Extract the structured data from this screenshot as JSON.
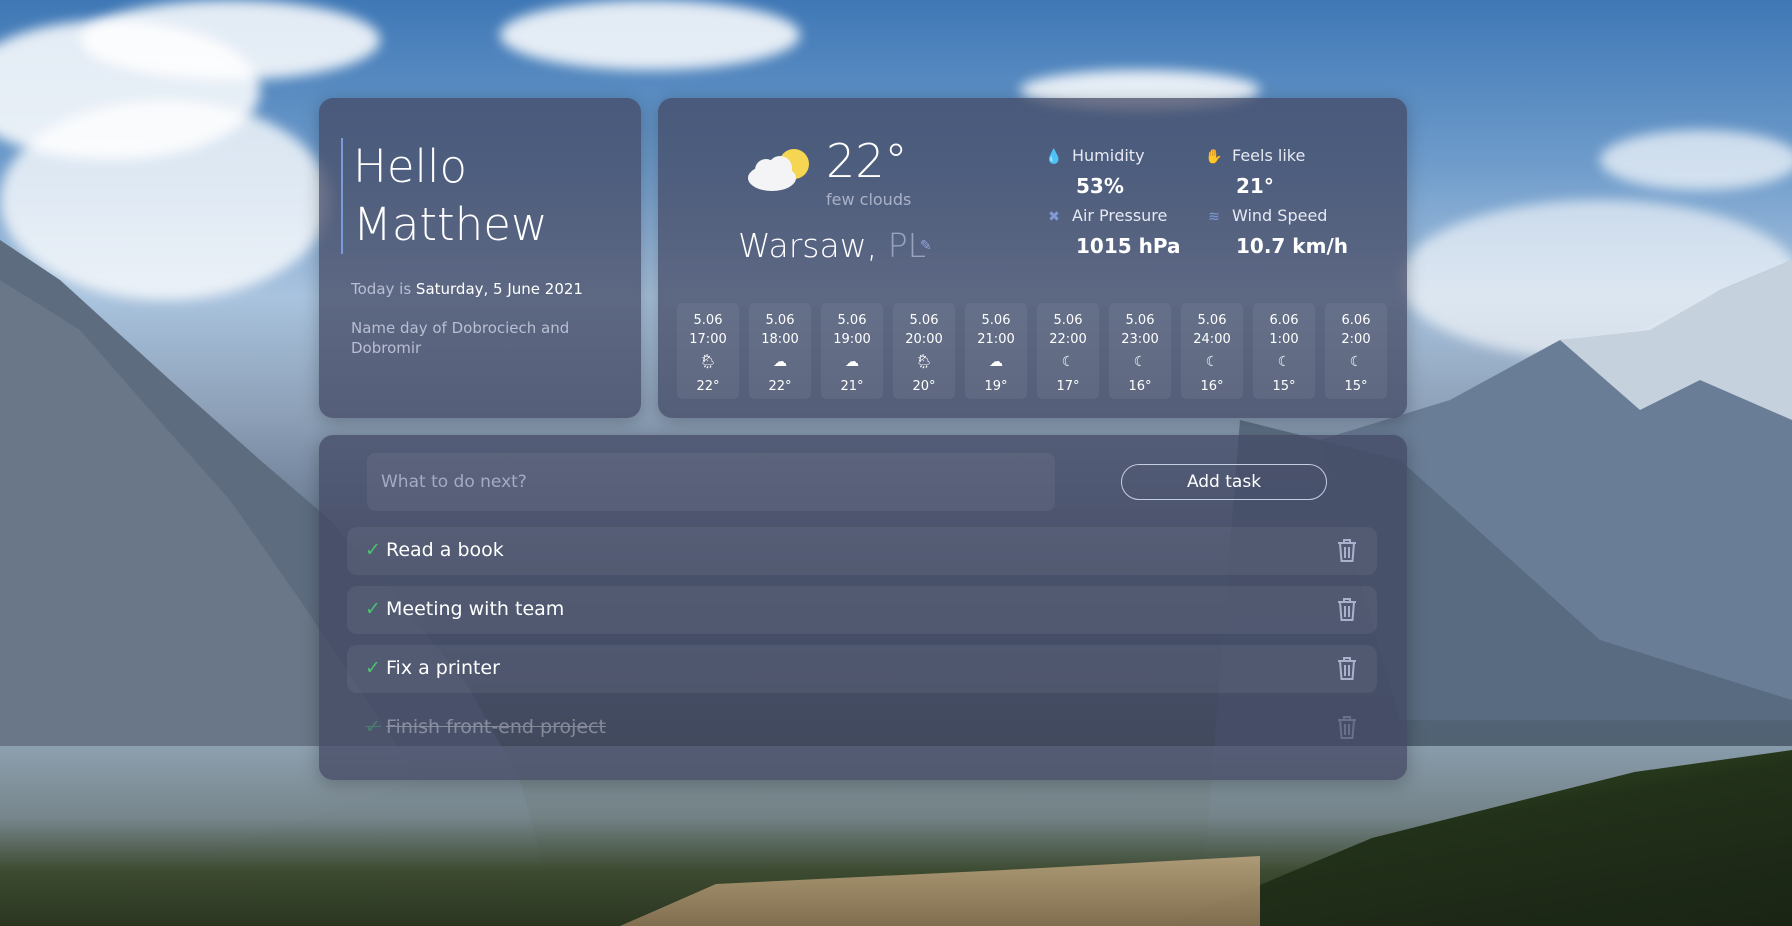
{
  "greeting": {
    "hello": "Hello",
    "name": "Matthew",
    "today_prefix": "Today is",
    "date": "Saturday, 5 June 2021",
    "nameday": "Name day of Dobrociech and Dobromir"
  },
  "weather": {
    "temperature": "22°",
    "description": "few clouds",
    "city": "Warsaw,",
    "country": "PL",
    "stats": {
      "humidity_label": "Humidity",
      "humidity_value": "53%",
      "feels_label": "Feels like",
      "feels_value": "21°",
      "pressure_label": "Air Pressure",
      "pressure_value": "1015 hPa",
      "wind_label": "Wind Speed",
      "wind_value": "10.7 km/h"
    },
    "forecast": [
      {
        "date": "5.06",
        "time": "17:00",
        "icon": "rain-sun-icon",
        "temp": "22°"
      },
      {
        "date": "5.06",
        "time": "18:00",
        "icon": "cloud-icon",
        "temp": "22°"
      },
      {
        "date": "5.06",
        "time": "19:00",
        "icon": "cloud-icon",
        "temp": "21°"
      },
      {
        "date": "5.06",
        "time": "20:00",
        "icon": "rain-sun-icon",
        "temp": "20°"
      },
      {
        "date": "5.06",
        "time": "21:00",
        "icon": "cloud-icon",
        "temp": "19°"
      },
      {
        "date": "5.06",
        "time": "22:00",
        "icon": "moon-cloud-icon",
        "temp": "17°"
      },
      {
        "date": "5.06",
        "time": "23:00",
        "icon": "moon-cloud-icon",
        "temp": "16°"
      },
      {
        "date": "5.06",
        "time": "24:00",
        "icon": "moon-cloud-icon",
        "temp": "16°"
      },
      {
        "date": "6.06",
        "time": "1:00",
        "icon": "moon-cloud-icon",
        "temp": "15°"
      },
      {
        "date": "6.06",
        "time": "2:00",
        "icon": "moon-cloud-icon",
        "temp": "15°"
      }
    ]
  },
  "tasks": {
    "input_placeholder": "What to do next?",
    "add_label": "Add task",
    "items": [
      {
        "label": "Read a book",
        "done": false
      },
      {
        "label": "Meeting with team",
        "done": false
      },
      {
        "label": "Fix a printer",
        "done": false
      },
      {
        "label": "Finish front-end project",
        "done": true
      }
    ],
    "check_mark": "✓"
  },
  "colors": {
    "panel": "#424862",
    "accent": "#7f9ad6",
    "check": "#49c46d"
  }
}
